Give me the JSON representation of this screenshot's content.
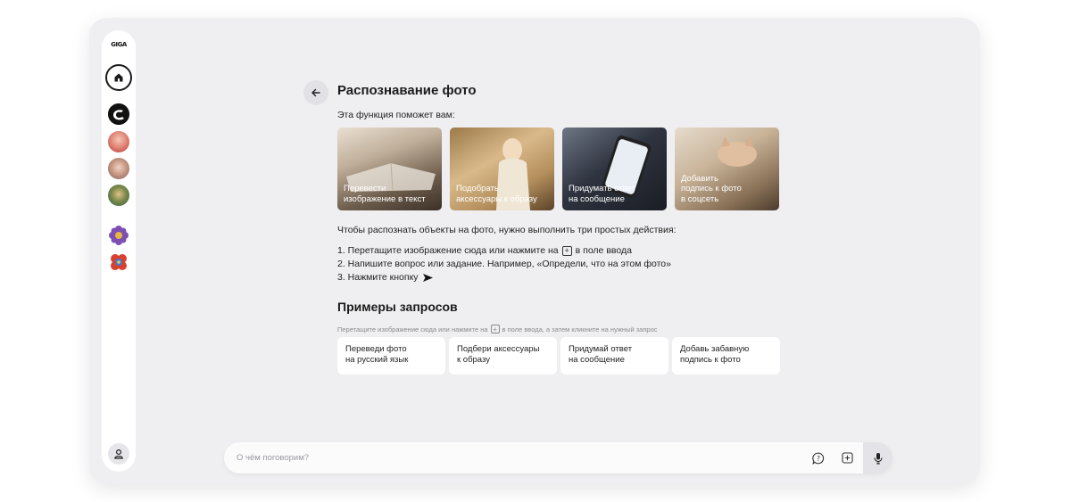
{
  "sidebar": {
    "logo_text": "GIGA",
    "home_icon": "home-icon",
    "avatars": [
      "assistant-logo",
      "avatar-woman-red",
      "avatar-woman-glasses",
      "avatar-man-green",
      "flower-purple",
      "flower-red"
    ],
    "profile_icon": "user-icon"
  },
  "header": {
    "back_icon": "arrow-left-icon",
    "title": "Распознавание фото"
  },
  "intro": "Эта функция поможет вам:",
  "feature_cards": [
    {
      "label": "Перевести\nизображение в текст"
    },
    {
      "label": "Подобрать\nаксессуары к образу"
    },
    {
      "label": "Придумать ответ\nна сообщение"
    },
    {
      "label": "Добавить\nподпись к фото\nв соцсеть"
    }
  ],
  "instructions": {
    "heading": "Чтобы распознать объекты на фото, нужно выполнить три простых действия:",
    "step1_a": "1. Перетащите изображение сюда или нажмите на",
    "step1_b": "в поле ввода",
    "step2": "2. Напишите вопрос или задание. Например, «Определи, что на этом фото»",
    "step3": "3. Нажмите кнопку"
  },
  "examples": {
    "title": "Примеры запросов",
    "hint_a": "Перетащите изображение сюда или нажмите на",
    "hint_b": "в поле ввода, а затем кликните на нужный запрос",
    "items": [
      {
        "label": "Переведи фото\nна русский язык"
      },
      {
        "label": "Подбери аксессуары\nк образу"
      },
      {
        "label": "Придумай ответ\nна сообщение"
      },
      {
        "label": "Добавь забавную\nподпись к фото"
      }
    ]
  },
  "input": {
    "placeholder": "О чём поговорим?",
    "value": ""
  },
  "colors": {
    "window_bg": "#efeff1",
    "panel_bg": "#ffffff",
    "text": "#1e1e1e",
    "muted": "#8a8a90"
  }
}
